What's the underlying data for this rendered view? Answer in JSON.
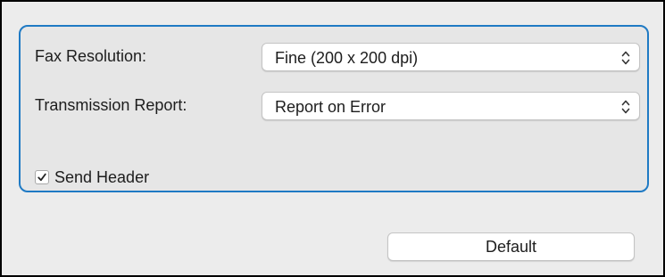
{
  "fax_settings": {
    "resolution": {
      "label": "Fax Resolution:",
      "value": "Fine (200 x 200 dpi)",
      "icon": "updown-chevron-icon"
    },
    "transmission_report": {
      "label": "Transmission Report:",
      "value": "Report on Error",
      "icon": "updown-chevron-icon"
    },
    "send_header": {
      "label": "Send Header",
      "checked": true
    }
  },
  "buttons": {
    "default_label": "Default"
  },
  "colors": {
    "focus_ring": "#1f7ac4",
    "window_border": "#000000",
    "background": "#ececec"
  }
}
